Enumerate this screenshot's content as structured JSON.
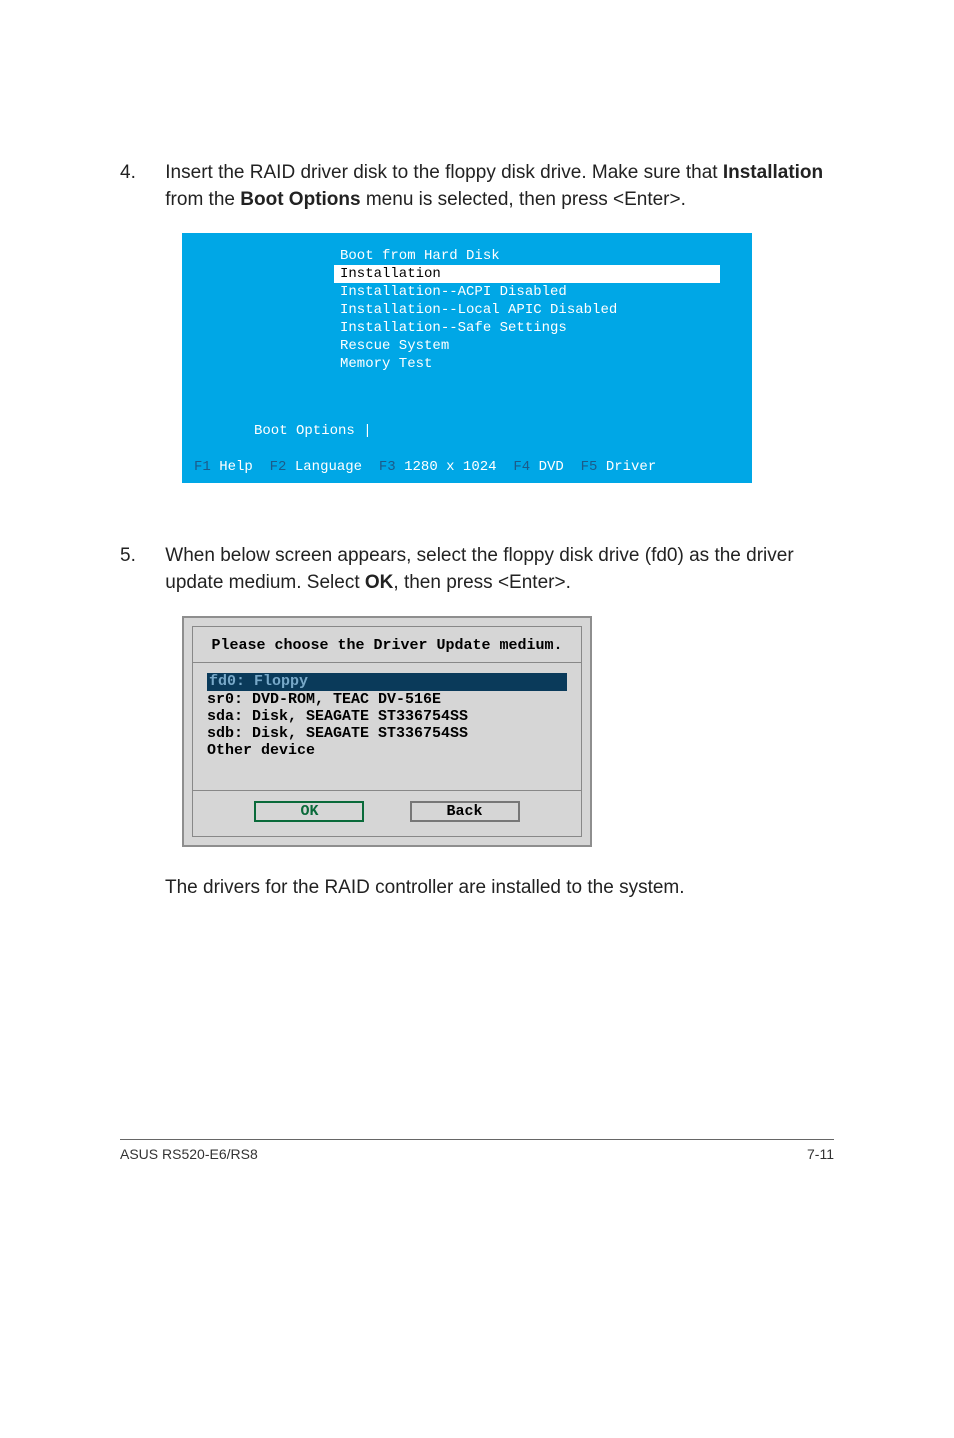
{
  "step4": {
    "number": "4.",
    "text_prefix": "Insert the RAID driver disk to the floppy disk drive. Make sure that ",
    "bold1": "Installation",
    "text_mid": " from the ",
    "bold2": "Boot Options",
    "text_suffix": " menu is selected, then press <Enter>."
  },
  "boot": {
    "items": [
      "Boot from Hard Disk",
      "Installation",
      "Installation--ACPI Disabled",
      "Installation--Local APIC Disabled",
      "Installation--Safe Settings",
      "Rescue System",
      "Memory Test"
    ],
    "selected_index": 1,
    "options_label": "Boot Options |",
    "fkeys": {
      "f1_label": "F1",
      "f1_value": "Help",
      "f2_label": "F2",
      "f2_value": "Language",
      "f3_label": "F3",
      "f3_value": "1280 x 1024",
      "f4_label": "F4",
      "f4_value": "DVD",
      "f5_label": "F5",
      "f5_value": "Driver"
    }
  },
  "step5": {
    "number": "5.",
    "text_prefix": "When below screen appears, select the floppy disk drive (fd0) as the driver update medium. Select ",
    "bold1": "OK",
    "text_suffix": ", then press <Enter>."
  },
  "dialog": {
    "title": "Please choose the Driver Update medium.",
    "items": [
      "fd0: Floppy",
      "sr0: DVD-ROM, TEAC DV-516E",
      "sda: Disk, SEAGATE ST336754SS",
      "sdb: Disk, SEAGATE ST336754SS",
      "Other device"
    ],
    "selected_index": 0,
    "ok_label": "OK",
    "back_label": "Back"
  },
  "post_note": "The drivers for the RAID controller are installed to the system.",
  "footer": {
    "left": "ASUS RS520-E6/RS8",
    "right": "7-11"
  }
}
